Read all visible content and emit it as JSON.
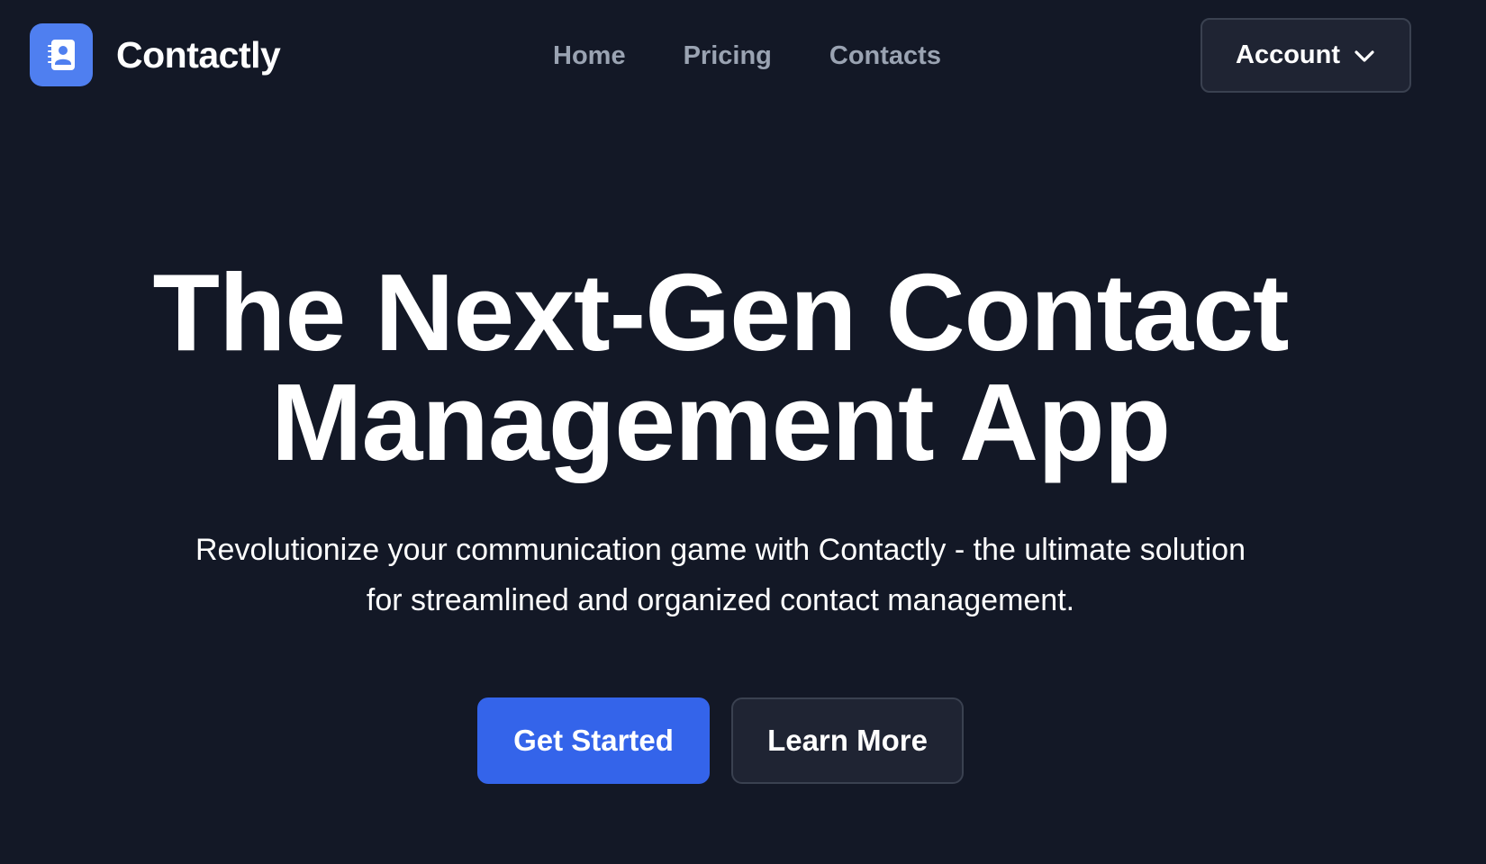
{
  "header": {
    "brand_name": "Contactly",
    "logo_icon": "contact-book-icon",
    "nav": [
      {
        "label": "Home"
      },
      {
        "label": "Pricing"
      },
      {
        "label": "Contacts"
      }
    ],
    "account_label": "Account",
    "account_icon": "chevron-down-icon"
  },
  "hero": {
    "title_line1": "The Next-Gen Contact",
    "title_line2": "Management App",
    "subtitle_line1": "Revolutionize your communication game with Contactly - the ultimate solution",
    "subtitle_line2": "for streamlined and organized contact management.",
    "primary_cta": "Get Started",
    "secondary_cta": "Learn More"
  },
  "colors": {
    "background": "#131826",
    "brand_blue": "#4f7ff0",
    "primary_button": "#3464ea",
    "nav_text": "#9aa3b2",
    "secondary_button": "#1f2433",
    "border": "#3a4150"
  }
}
